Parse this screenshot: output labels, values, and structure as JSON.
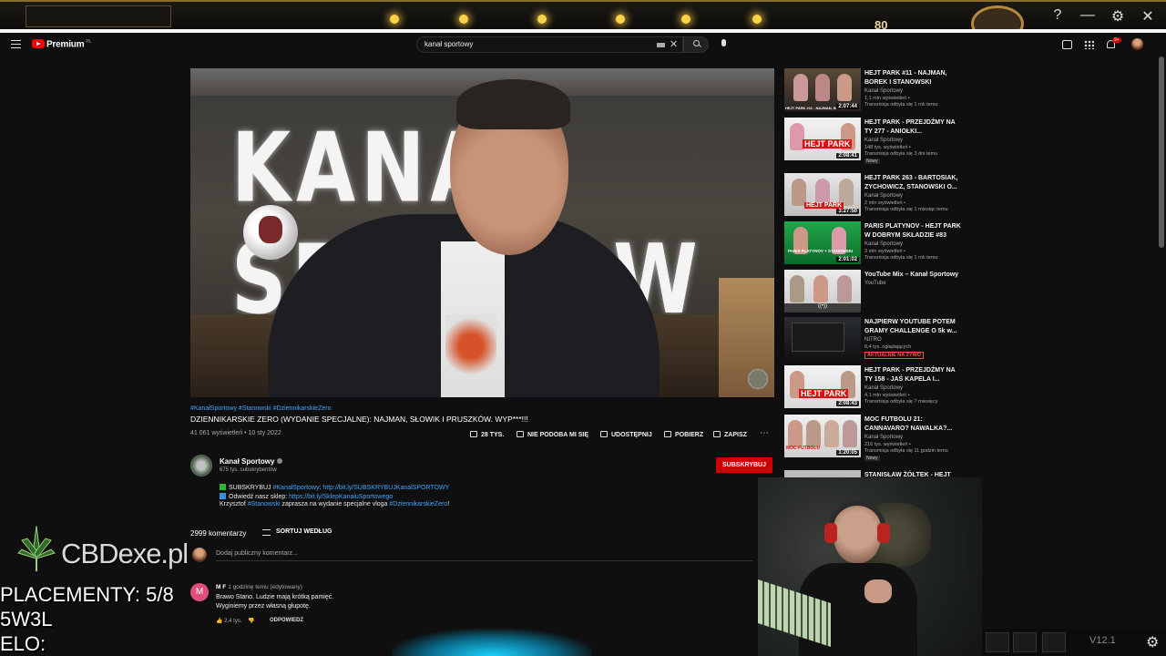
{
  "top_overlay": {
    "coin_count": "80",
    "help_icon": "?",
    "minimize_icon": "—",
    "settings_icon": "⚙",
    "close_icon": "✕"
  },
  "header": {
    "brand": "Premium",
    "brand_region": "PL",
    "search_query": "kanał sportowy",
    "notification_count": "9+"
  },
  "video": {
    "wall_text": "KANAŁ SPORTOW",
    "hashtags": "#KanałSportowy #Stanowski #DziennikarskieZero",
    "title": "DZIENNIKARSKIE ZERO (WYDANIE SPECJALNE): NAJMAN, SŁOWIK I PRUSZKÓW. WYP***!!!",
    "meta": "41 061 wyświetleń • 10 sty 2022",
    "actions": {
      "like": "28 TYS.",
      "dislike": "NIE PODOBA MI SIĘ",
      "share": "UDOSTĘPNIJ",
      "download": "POBIERZ",
      "save": "ZAPISZ",
      "more": "⋯"
    }
  },
  "channel": {
    "name": "Kanał Sportowy",
    "subs": "675 tys. subskrybentów",
    "subscribe": "SUBSKRYBUJ"
  },
  "description": {
    "line1_a": "SUBSKRYBUJ ",
    "line1_tag": "#KanałSportowy",
    "line1_b": ": ",
    "line1_link": "http://bit.ly/SUBSKRYBUJKanalSPORTOWY",
    "line2_a": "Odwiedź nasz sklep: ",
    "line2_link": "https://bit.ly/SklepKanaluSportowego",
    "line3_a": "Krzysztof ",
    "line3_tag": "#Stanowski",
    "line3_b": " zaprasza na wydanie specjalne vloga ",
    "line3_tag2": "#DziennikarskieZero",
    "line3_c": "!"
  },
  "comments": {
    "count": "2999 komentarzy",
    "sort": "SORTUJ WEDŁUG",
    "placeholder": "Dodaj publiczny komentarz...",
    "first": {
      "avatar": "M",
      "author": "M F",
      "time": "1 godzinę temu (edytowany)",
      "line1": "Brawo Stano. Ludzie mają krótką pamięć.",
      "line2": "Wyginiemy przez własną głupotę.",
      "likes": "2,4 tys.",
      "reply": "ODPOWIEDZ"
    }
  },
  "recommendations": [
    {
      "title": "HEJT PARK #11 - NAJMAN, BOREK I STANOWSKI",
      "channel": "Kanał Sportowy",
      "views": "1,1 mln wyświetleń •",
      "time": "Transmisja odbyła się 1 rok temu",
      "duration": "2:07:44",
      "thumb_text": "HEJT PARK #11 - NAJMAN, BOREK",
      "badge": ""
    },
    {
      "title": "HEJT PARK - PRZEJDŹMY NA TY 277 - ANIOŁKI...",
      "channel": "Kanał Sportowy",
      "views": "148 tys. wyświetleń •",
      "time": "Transmisja odbyła się 3 dni temu",
      "duration": "2:08:41",
      "thumb_text": "HEJT PARK",
      "badge": "Nowy"
    },
    {
      "title": "HEJT PARK 263 - BARTOSIAK, ZYCHOWICZ, STANOWSKI O...",
      "channel": "Kanał Sportowy",
      "views": "2 mln wyświetleń •",
      "time": "Transmisja odbyła się 1 miesiąc temu",
      "duration": "3:27:50",
      "thumb_text": "HEJT PARK",
      "badge": ""
    },
    {
      "title": "PARIS PLATYNOV - HEJT PARK W DOBRYM SKŁADZIE #83",
      "channel": "Kanał Sportowy",
      "views": "3 mln wyświetleń •",
      "time": "Transmisja odbyła się 1 rok temu",
      "duration": "2:01:02",
      "thumb_text": "PARIS PLATYNOV + STANOWSKI",
      "badge": ""
    },
    {
      "title": "YouTube Mix – Kanał Sportowy",
      "channel": "YouTube",
      "views": "",
      "time": "",
      "duration": "",
      "thumb_text": "((•))",
      "badge": ""
    },
    {
      "title": "NAJPIERW YOUTUBE POTEM GRAMY CHALLENGE O 5k w...",
      "channel": "NITRO",
      "views": "8,4 tys. oglądających",
      "time": "",
      "duration": "",
      "thumb_text": "",
      "badge": "",
      "live": "AKTUALNIE NA ŻYWO"
    },
    {
      "title": "HEJT PARK - PRZEJDŹMY NA TY 158 - JAŚ KAPELA I...",
      "channel": "Kanał Sportowy",
      "views": "4,1 mln wyświetleń •",
      "time": "Transmisja odbyła się 7 miesięcy",
      "duration": "2:08:43",
      "thumb_text": "HEJT PARK",
      "badge": ""
    },
    {
      "title": "MOC FUTBOLU 21: CANNAVARO? NAWALKA?...",
      "channel": "Kanał Sportowy",
      "views": "216 tys. wyświetleń •",
      "time": "Transmisja odbyła się 11 godzin temu",
      "duration": "1:20:05",
      "thumb_text": "MOC FUTBOLU",
      "badge": "Nowy"
    },
    {
      "title": "STANISŁAW ŻÓŁTEK - HEJT",
      "channel": "",
      "views": "",
      "time": "",
      "duration": "",
      "thumb_text": "",
      "badge": ""
    }
  ],
  "stream_overlay": {
    "sponsor": "CBDexe.pl",
    "placements": "PLACEMENTY: 5/8",
    "record": "5W3L",
    "elo": "ELO:",
    "version": "V12.1"
  }
}
